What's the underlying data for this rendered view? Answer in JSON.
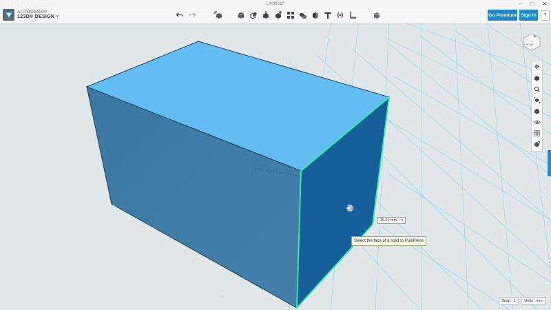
{
  "window": {
    "title": "Untitled*",
    "controls": [
      "–",
      "□",
      "✕"
    ]
  },
  "brand": {
    "company": "AUTODESK®",
    "product": "123D® DESIGN",
    "menu_glyph": "⌄"
  },
  "toolbar": {
    "tools": [
      {
        "name": "undo-icon"
      },
      {
        "name": "redo-icon"
      },
      {
        "name": "transform-icon"
      },
      {
        "name": "primitives-icon"
      },
      {
        "name": "sketch-icon"
      },
      {
        "name": "construct-icon"
      },
      {
        "name": "modify-icon"
      },
      {
        "name": "pattern-icon"
      },
      {
        "name": "group-icon"
      },
      {
        "name": "combine-icon"
      },
      {
        "name": "text-icon"
      },
      {
        "name": "snap-icon"
      },
      {
        "name": "measure-icon"
      },
      {
        "name": "material-icon"
      }
    ]
  },
  "account": {
    "premium_label": "Go Premium",
    "signin_label": "Sign In",
    "help_label": "?"
  },
  "viewcube": {
    "face_label": "FRONT"
  },
  "navigation": {
    "tools": [
      "pan-icon",
      "orbit-icon",
      "zoom-icon",
      "fit-icon",
      "views-icon",
      "visibility-icon",
      "grid-icon",
      "material-view-icon"
    ]
  },
  "canvas": {
    "dimension_value": "15.50 mm",
    "tooltip": "Select the face of a solid to Pull/Press",
    "snap_label": "Snap : 1",
    "units_label": "Units : mm"
  },
  "colors": {
    "top_face": "#63bcf2",
    "front_face": "#3c7fab",
    "side_face": "#155f93",
    "highlight": "#2ff6a0",
    "grid": "#8fd7e4",
    "accent": "#1e88c8"
  }
}
